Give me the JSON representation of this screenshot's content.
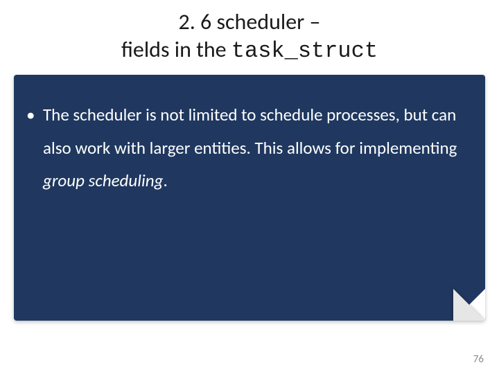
{
  "title": {
    "line1": "2. 6 scheduler –",
    "line2_prefix": "fields in the ",
    "code": "task_struct"
  },
  "bullet": {
    "text_before_italic": "The scheduler is not limited to schedule processes, but can also work with larger entities. This allows for implementing ",
    "italic": "group scheduling",
    "text_after_italic": "."
  },
  "page_number": "76"
}
